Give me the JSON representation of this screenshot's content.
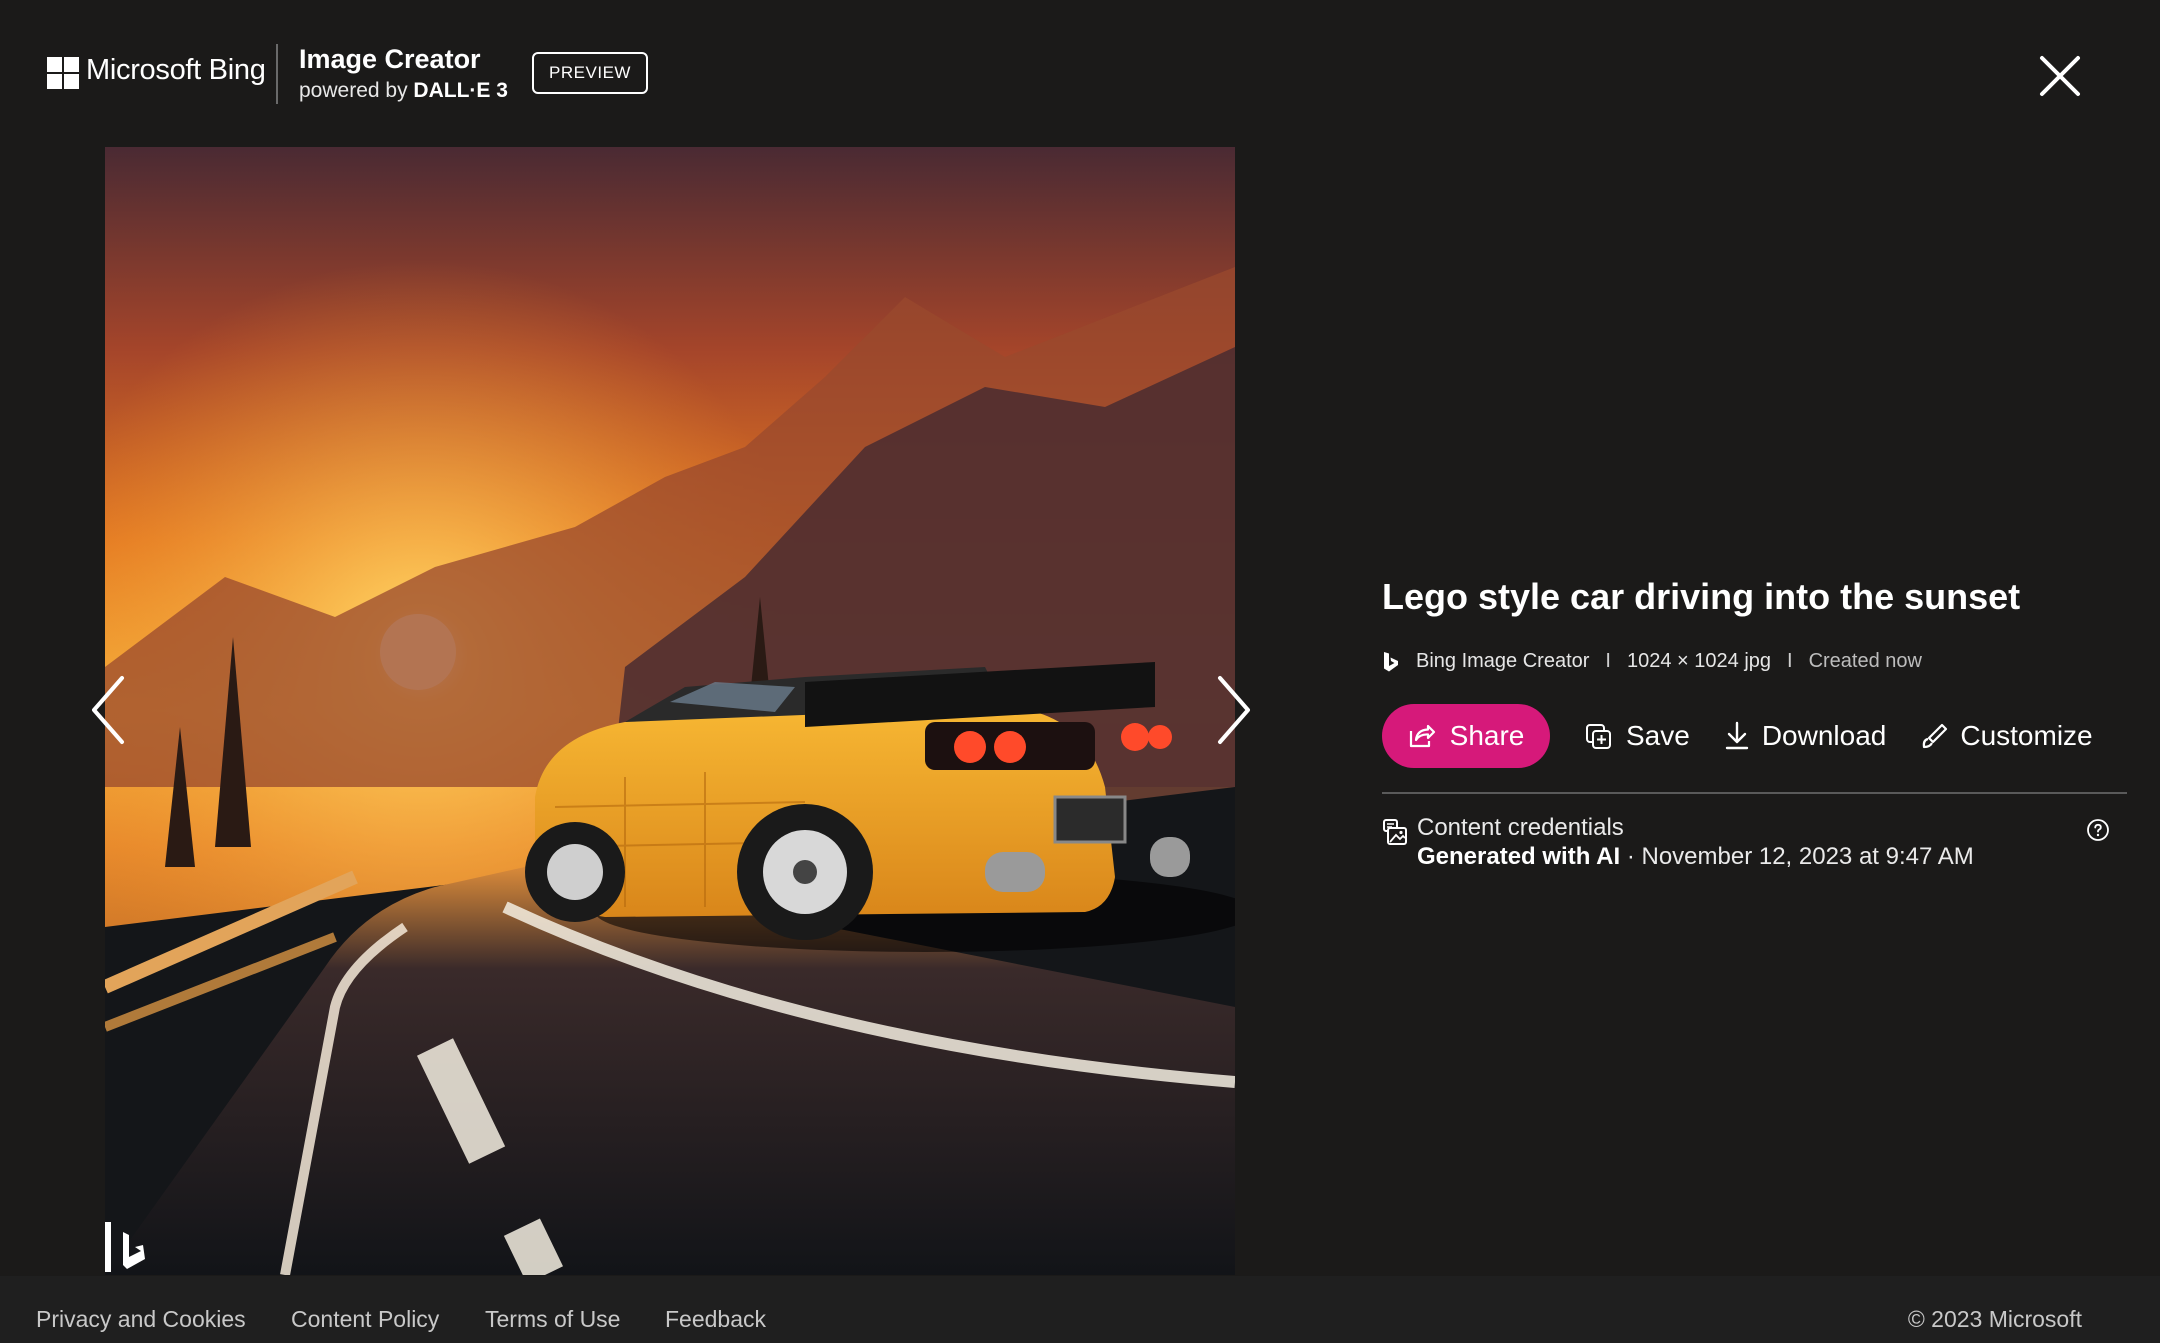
{
  "header": {
    "brand": "Microsoft Bing",
    "product_title": "Image Creator",
    "powered_prefix": "powered by ",
    "powered_model": "DALL·E 3",
    "badge": "PREVIEW",
    "close_icon": "close-icon"
  },
  "image": {
    "alt": "Lego style car driving into the sunset",
    "watermark_icon": "bing-logo-icon"
  },
  "navigation": {
    "prev_icon": "chevron-left-icon",
    "next_icon": "chevron-right-icon"
  },
  "details": {
    "title": "Lego style car driving into the sunset",
    "source": "Bing Image Creator",
    "separator": "I",
    "dimensions": "1024 × 1024 jpg",
    "created": "Created now",
    "actions": {
      "share": "Share",
      "save": "Save",
      "download": "Download",
      "customize": "Customize"
    },
    "credentials": {
      "label": "Content credentials",
      "generated": "Generated with AI",
      "date": " · November 12, 2023 at 9:47 AM"
    }
  },
  "footer": {
    "links": [
      "Privacy and Cookies",
      "Content Policy",
      "Terms of Use",
      "Feedback"
    ],
    "copyright": "© 2023 Microsoft"
  },
  "colors": {
    "background": "#1b1a19",
    "share_button": "#d6197a",
    "footer_bg": "#1f1f1f"
  }
}
